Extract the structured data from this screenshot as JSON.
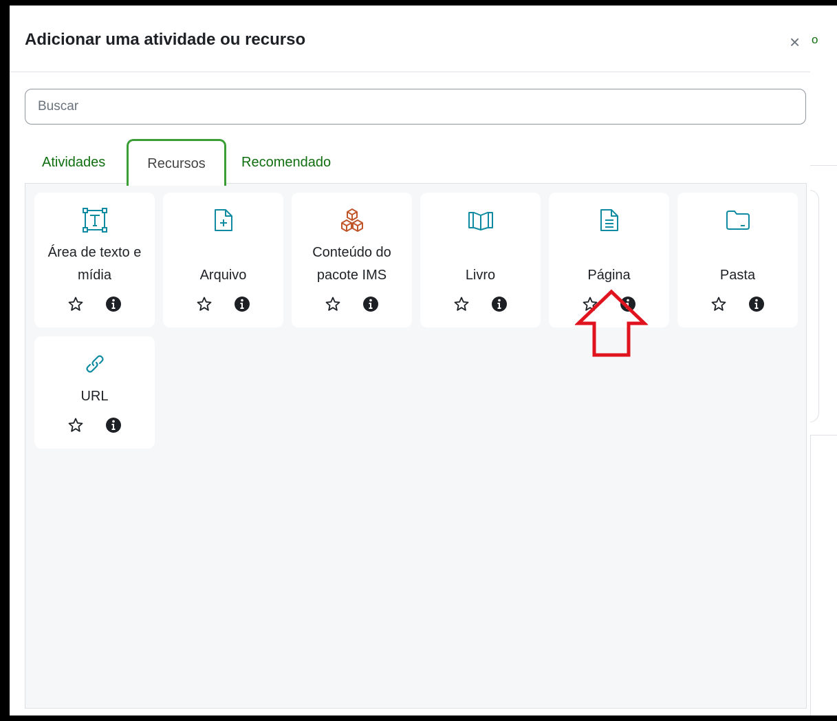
{
  "modal": {
    "title": "Adicionar uma atividade ou recurso",
    "close_symbol": "×"
  },
  "background_page": {
    "partial_text": "o"
  },
  "search": {
    "placeholder": "Buscar",
    "value": ""
  },
  "tabs": [
    {
      "label": "Atividades",
      "active": false
    },
    {
      "label": "Recursos",
      "active": true
    },
    {
      "label": "Recomendado",
      "active": false
    }
  ],
  "items": [
    {
      "label": "Área de texto e mídia",
      "icon": "text-media-area-icon",
      "color": "#0f8ba1"
    },
    {
      "label": "Arquivo",
      "icon": "file-plus-icon",
      "color": "#0f8ba1"
    },
    {
      "label": "Conteúdo do pacote IMS",
      "icon": "package-cubes-icon",
      "color": "#c2562b"
    },
    {
      "label": "Livro",
      "icon": "book-icon",
      "color": "#0f8ba1"
    },
    {
      "label": "Página",
      "icon": "page-document-icon",
      "color": "#0f8ba1"
    },
    {
      "label": "Pasta",
      "icon": "folder-icon",
      "color": "#0f8ba1"
    },
    {
      "label": "URL",
      "icon": "link-icon",
      "color": "#0f8ba1"
    }
  ],
  "annotation": {
    "icon": "red-up-arrow-icon",
    "color": "#e0141e"
  },
  "colors": {
    "tab_link": "#0f6e0f",
    "active_tab_border": "#3a9d35",
    "content_background": "#f5f7f8"
  }
}
